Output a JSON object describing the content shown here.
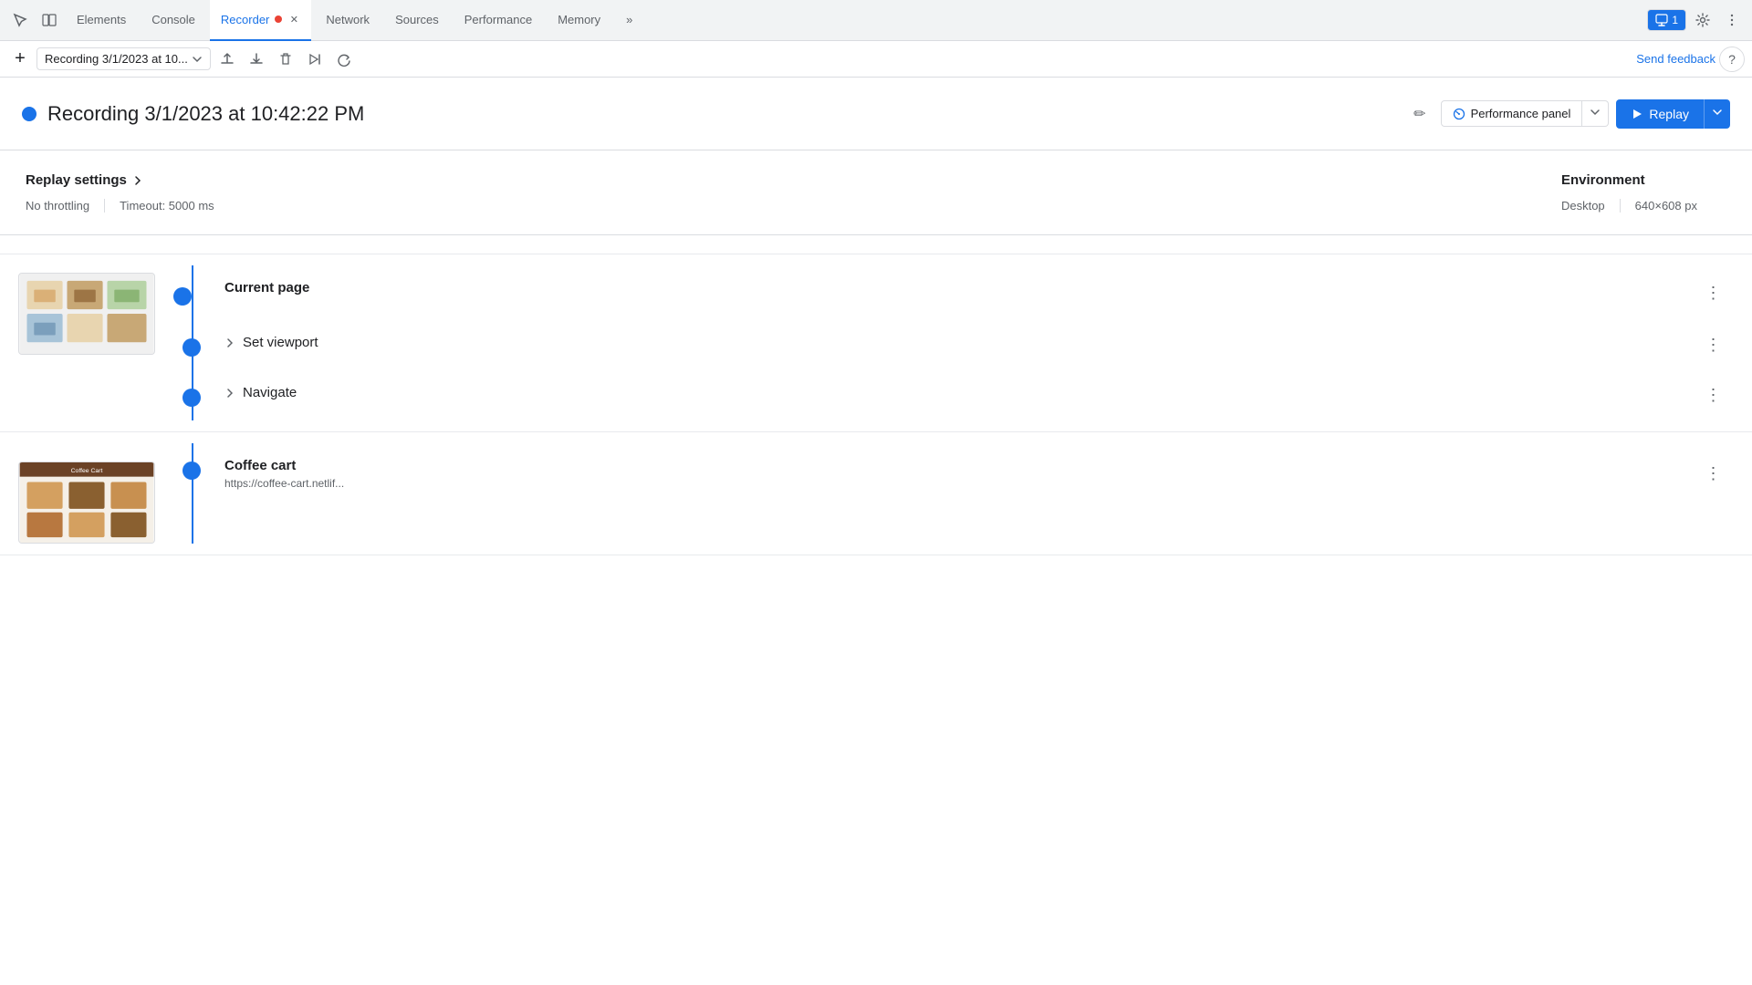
{
  "tabs": {
    "items": [
      {
        "label": "Elements",
        "active": false,
        "id": "elements"
      },
      {
        "label": "Console",
        "active": false,
        "id": "console"
      },
      {
        "label": "Recorder",
        "active": true,
        "id": "recorder",
        "hasClose": true,
        "hasDot": true
      },
      {
        "label": "Network",
        "active": false,
        "id": "network"
      },
      {
        "label": "Sources",
        "active": false,
        "id": "sources"
      },
      {
        "label": "Performance",
        "active": false,
        "id": "performance"
      },
      {
        "label": "Memory",
        "active": false,
        "id": "memory"
      }
    ],
    "overflow_label": "»",
    "notification_count": "1"
  },
  "toolbar": {
    "add_label": "+",
    "recording_name": "Recording 3/1/2023 at 10...",
    "send_feedback": "Send feedback"
  },
  "recording": {
    "title": "Recording 3/1/2023 at 10:42:22 PM",
    "status_color": "#1a73e8",
    "perf_panel_label": "Performance panel",
    "replay_label": "Replay"
  },
  "replay_settings": {
    "title": "Replay settings",
    "throttling": "No throttling",
    "timeout": "Timeout: 5000 ms",
    "env_title": "Environment",
    "env_type": "Desktop",
    "env_resolution": "640×608 px"
  },
  "steps": {
    "section1": {
      "label": "Current page",
      "sub_items": [
        {
          "label": "Set viewport",
          "expandable": true
        },
        {
          "label": "Navigate",
          "expandable": true
        }
      ]
    },
    "section2": {
      "label": "Coffee cart",
      "url": "https://coffee-cart.netlif..."
    }
  },
  "icons": {
    "cursor": "↖",
    "edit": "✏",
    "play": "▶",
    "chevron_down": "▾",
    "chevron_right": "▶",
    "expand_right": "▶",
    "kebab": "⋮",
    "plus": "+",
    "upload": "↑",
    "download": "↓",
    "trash": "🗑",
    "step_into": "▷",
    "replay_icon": "↺",
    "help": "?",
    "gear": "⚙",
    "more": "⋮",
    "perf_icon": "⚡"
  }
}
